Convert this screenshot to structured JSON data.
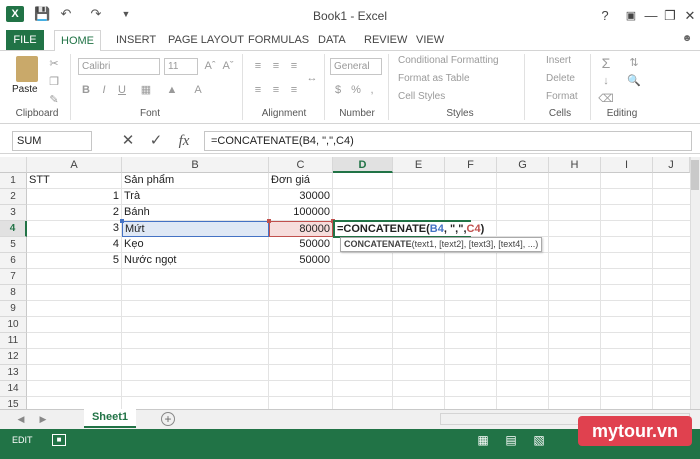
{
  "title_bar": {
    "doc_title": "Book1 - Excel",
    "help": "?",
    "minimize": "—",
    "restore": "❐",
    "close": "✕",
    "logo": "X"
  },
  "tabs": [
    "FILE",
    "HOME",
    "INSERT",
    "PAGE LAYOUT",
    "FORMULAS",
    "DATA",
    "REVIEW",
    "VIEW"
  ],
  "clipboard": {
    "paste": "Paste",
    "label": "Clipboard"
  },
  "font": {
    "name": "Calibri",
    "size": "11",
    "label": "Font",
    "bold": "B",
    "italic": "I",
    "underline": "U"
  },
  "alignment": {
    "label": "Alignment"
  },
  "number": {
    "format": "General",
    "label": "Number",
    "currency": "$",
    "percent": "%",
    "comma": ","
  },
  "styles": {
    "conditional": "Conditional Formatting",
    "table": "Format as Table",
    "cell": "Cell Styles",
    "label": "Styles"
  },
  "cells": {
    "insert": "Insert",
    "delete": "Delete",
    "format": "Format",
    "label": "Cells"
  },
  "editing": {
    "label": "Editing"
  },
  "formula_bar": {
    "name_box": "SUM",
    "formula": "=CONCATENATE(B4, \",\",C4)",
    "cancel": "✕",
    "enter": "✓",
    "fx": "fx"
  },
  "columns": [
    "A",
    "B",
    "C",
    "D",
    "E",
    "F",
    "G",
    "H",
    "I",
    "J"
  ],
  "rows": [
    "1",
    "2",
    "3",
    "4",
    "5",
    "6",
    "7",
    "8",
    "9",
    "10",
    "11",
    "12",
    "13",
    "14",
    "15"
  ],
  "cells_data": {
    "a1": "STT",
    "b1": "Sản phẩm",
    "c1": "Đơn giá",
    "a2": "1",
    "b2": "Trà",
    "c2": "30000",
    "a3": "2",
    "b3": "Bánh",
    "c3": "100000",
    "a4": "3",
    "b4": "Mứt",
    "c4": "80000",
    "a5": "4",
    "b5": "Kẹo",
    "c5": "50000",
    "a6": "5",
    "b6": "Nước ngọt",
    "c6": "50000"
  },
  "edit_cell": {
    "prefix": "=CONCATENATE(",
    "ref1": "B4",
    "mid": ", \",\",",
    "ref2": "C4",
    "suffix": ")"
  },
  "tooltip": {
    "fn": "CONCATENATE",
    "args": "(text1, [text2], [text3], [text4], ...)"
  },
  "sheet": {
    "name": "Sheet1",
    "add": "+"
  },
  "status": {
    "mode": "EDIT"
  },
  "watermark": "mytour.vn",
  "colors": {
    "accent": "#217346",
    "ref_blue": "#4472c4",
    "ref_red": "#c0504d"
  }
}
